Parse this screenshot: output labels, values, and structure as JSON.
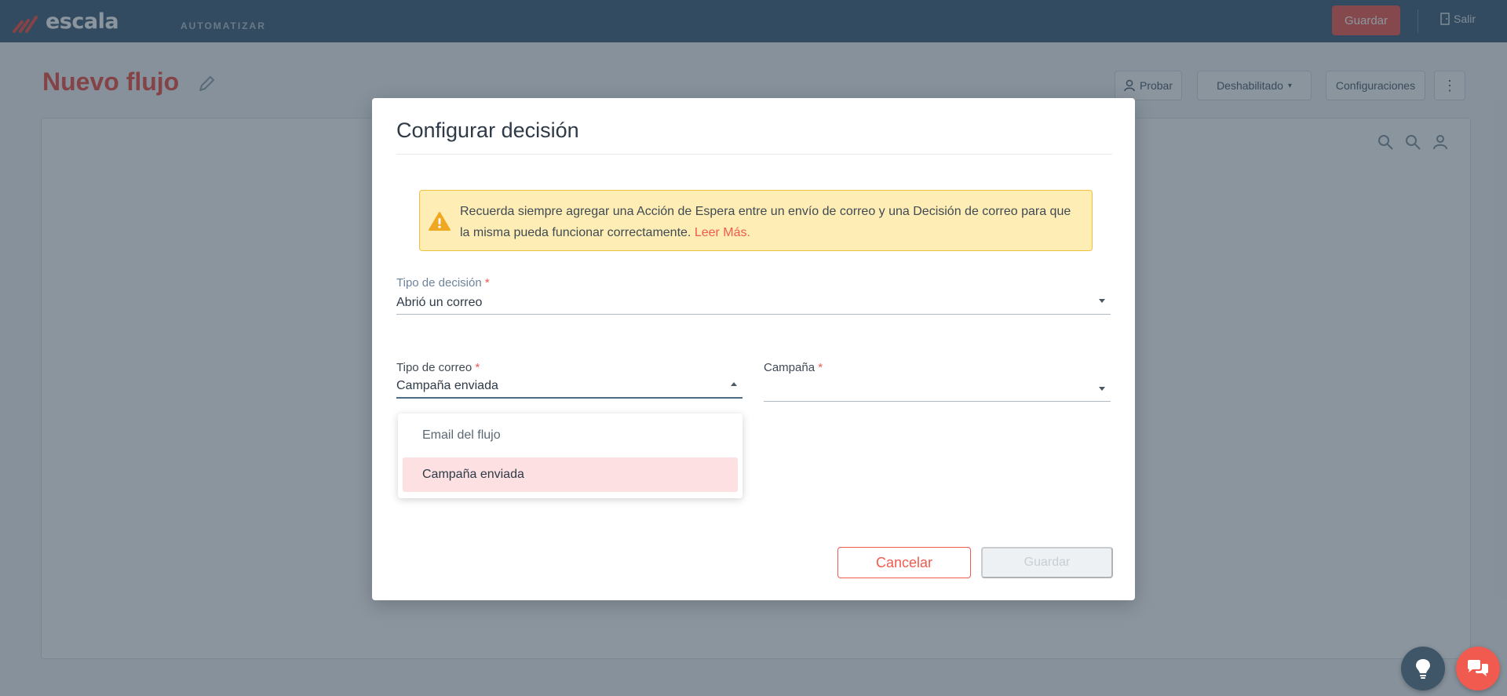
{
  "app": {
    "logo_text": "escala",
    "section": "AUTOMATIZAR",
    "save_label": "Guardar",
    "exit_label": "Salir"
  },
  "page": {
    "title": "Nuevo flujo",
    "toolbar": {
      "test_label": "Probar",
      "status_label": "Deshabilitado",
      "settings_label": "Configuraciones"
    }
  },
  "modal": {
    "title": "Configurar decisión",
    "alert": {
      "text": "Recuerda siempre agregar una Acción de Espera entre un envío de correo y una Decisión de correo para que la misma pueda funcionar correctamente.",
      "link": "Leer Más."
    },
    "decision_type": {
      "label": "Tipo de decisión",
      "required_mark": "*",
      "value": "Abrió un correo"
    },
    "email_type": {
      "label": "Tipo de correo",
      "required_mark": "*",
      "value": "Campaña enviada",
      "options": [
        "Email del flujo",
        "Campaña enviada"
      ],
      "selected_index": 1
    },
    "campaign": {
      "label": "Campaña",
      "required_mark": "*",
      "value": ""
    },
    "cancel_label": "Cancelar",
    "save_label": "Guardar"
  },
  "colors": {
    "brand": "#f05a4f",
    "header": "#4f6b82",
    "alert_bg": "#feeeb5",
    "alert_border": "#f0c23c",
    "selected_option": "#fde0e1"
  }
}
